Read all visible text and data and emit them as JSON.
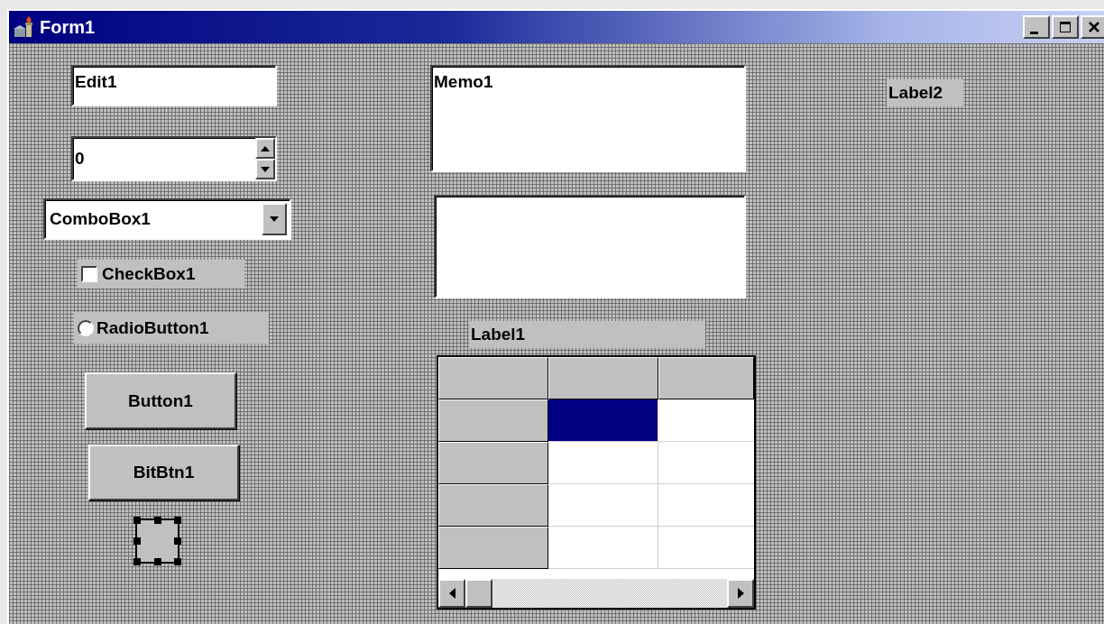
{
  "window": {
    "title": "Form1"
  },
  "edit": {
    "value": "Edit1"
  },
  "spin_edit": {
    "value": "0"
  },
  "combo_box": {
    "value": "ComboBox1"
  },
  "check_box": {
    "label": "CheckBox1",
    "checked": false
  },
  "radio_button": {
    "label": "RadioButton1",
    "selected": false
  },
  "buttons": [
    "Button1",
    "BitBtn1"
  ],
  "panel": {
    "selected": true
  },
  "memo": {
    "value": "Memo1"
  },
  "label_1": "Label1",
  "label_2": "Label2",
  "grid": {
    "rows": [
      {
        "cells": [
          {
            "selected": true
          },
          {
            "selected": false
          }
        ]
      },
      {
        "cells": [
          {
            "selected": false
          },
          {
            "selected": false
          }
        ]
      },
      {
        "cells": [
          {
            "selected": false
          },
          {
            "selected": false
          }
        ]
      },
      {
        "cells": [
          {
            "selected": false
          },
          {
            "selected": false
          }
        ]
      }
    ]
  }
}
